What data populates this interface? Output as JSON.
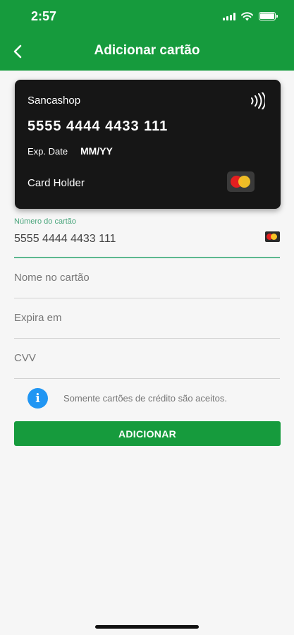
{
  "status_bar": {
    "time": "2:57"
  },
  "header": {
    "title": "Adicionar cartão"
  },
  "card_preview": {
    "brand": "Sancashop",
    "number": "5555 4444 4433 111",
    "exp_label": "Exp. Date",
    "exp_value": "MM/YY",
    "holder": "Card Holder"
  },
  "form": {
    "card_number": {
      "label": "Número do cartão",
      "value": "5555 4444 4433 111"
    },
    "card_name": {
      "placeholder": "Nome no cartão"
    },
    "expiry": {
      "placeholder": "Expira em"
    },
    "cvv": {
      "placeholder": "CVV"
    }
  },
  "info": {
    "text": "Somente cartões de crédito são aceitos."
  },
  "actions": {
    "add_label": "ADICIONAR"
  },
  "colors": {
    "primary": "#169b3d",
    "card_bg": "#161616",
    "info_blue": "#2196f3",
    "mastercard_red": "#e41f20",
    "mastercard_yellow": "#f7c325"
  },
  "icons": [
    "back-chevron-icon",
    "wifi-icon",
    "battery-icon",
    "signal-icon",
    "contactless-icon",
    "mastercard-icon",
    "info-icon"
  ]
}
